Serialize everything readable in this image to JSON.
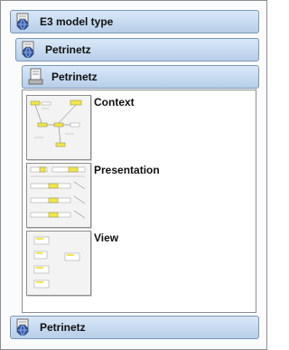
{
  "tree": {
    "level1": {
      "label": "E3 model type",
      "icon": "model-type-icon"
    },
    "level2": {
      "label": "Petrinetz",
      "icon": "model-type-icon"
    },
    "level3": {
      "label": "Petrinetz",
      "icon": "model-icon"
    },
    "views": [
      {
        "label": "Context",
        "thumbnail": "context-diagram-thumbnail"
      },
      {
        "label": "Presentation",
        "thumbnail": "presentation-diagram-thumbnail"
      },
      {
        "label": "View",
        "thumbnail": "view-diagram-thumbnail"
      }
    ],
    "footer": {
      "label": "Petrinetz",
      "icon": "model-type-icon"
    }
  },
  "colors": {
    "header_top": "#d9e8f8",
    "header_bottom": "#b7cee8",
    "header_border": "#7b97b8",
    "thumb_node": "#f2e64a"
  }
}
